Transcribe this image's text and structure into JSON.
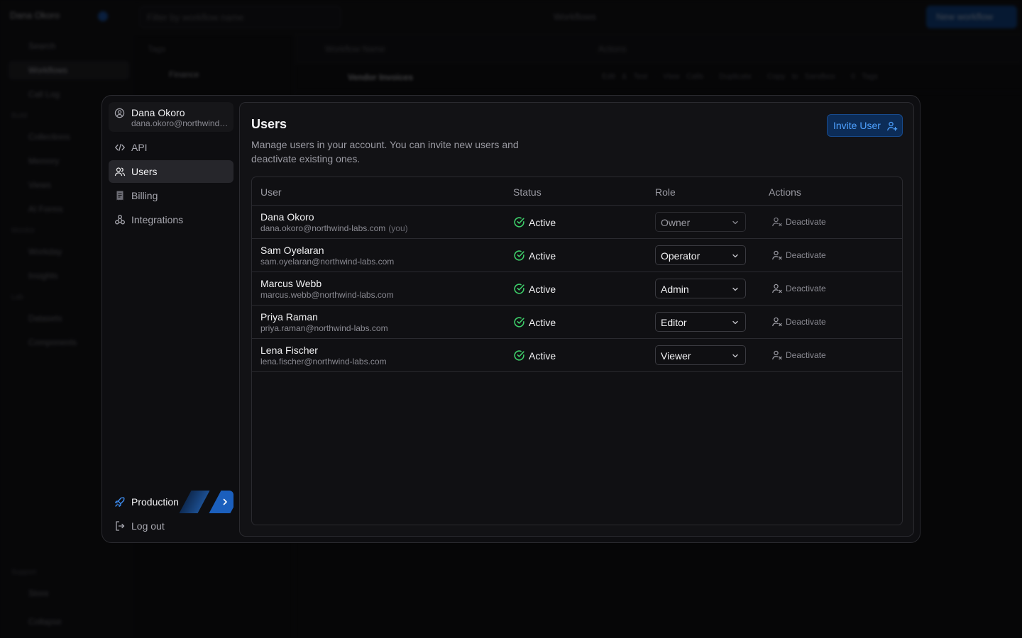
{
  "background": {
    "user_name": "Dana Okoro",
    "search_placeholder": "Filter by workflow name",
    "breadcrumb": "Workflows",
    "new_button": "New workflow",
    "nav": [
      {
        "label": "Search"
      },
      {
        "label": "Workflows"
      },
      {
        "label": "Call Log"
      },
      {
        "label": "Collections"
      },
      {
        "label": "Memory"
      },
      {
        "label": "Views"
      },
      {
        "label": "AI Forms"
      },
      {
        "label": "Workday"
      },
      {
        "label": "Insights"
      },
      {
        "label": "Datasets"
      },
      {
        "label": "Components"
      },
      {
        "label": "Store"
      },
      {
        "label": "Collapse"
      }
    ],
    "sections": [
      "Build",
      "Monitor",
      "Lab",
      "Support"
    ],
    "tags_header": "Tags",
    "tag_item": "Finance",
    "table_headers": [
      "Workflow Name",
      "Actions"
    ],
    "row_name": "Vendor Invoices",
    "row_actions": "Edit & Test · View Calls · Duplicate · Copy to Sandbox · 0 Tags"
  },
  "settings": {
    "profile": {
      "name": "Dana Okoro",
      "email": "dana.okoro@northwind-labs.com"
    },
    "nav": [
      {
        "label": "API",
        "icon": "code-icon",
        "active": false
      },
      {
        "label": "Users",
        "icon": "users-icon",
        "active": true
      },
      {
        "label": "Billing",
        "icon": "billing-icon",
        "active": false
      },
      {
        "label": "Integrations",
        "icon": "integrations-icon",
        "active": false
      }
    ],
    "environment": {
      "label": "Production",
      "icon": "rocket-icon"
    },
    "logout_label": "Log out"
  },
  "users_page": {
    "title": "Users",
    "description": "Manage users in your account. You can invite new users and deactivate existing ones.",
    "invite_label": "Invite User",
    "columns": [
      "User",
      "Status",
      "Role",
      "Actions"
    ],
    "rows": [
      {
        "name": "Dana Okoro",
        "email": "dana.okoro@northwind-labs.com",
        "you": "(you)",
        "status": "Active",
        "role": "Owner",
        "action": "Deactivate"
      },
      {
        "name": "Sam Oyelaran",
        "email": "sam.oyelaran@northwind-labs.com",
        "status": "Active",
        "role": "Operator",
        "action": "Deactivate"
      },
      {
        "name": "Marcus Webb",
        "email": "marcus.webb@northwind-labs.com",
        "status": "Active",
        "role": "Admin",
        "action": "Deactivate"
      },
      {
        "name": "Priya Raman",
        "email": "priya.raman@northwind-labs.com",
        "status": "Active",
        "role": "Editor",
        "action": "Deactivate"
      },
      {
        "name": "Lena Fischer",
        "email": "lena.fischer@northwind-labs.com",
        "status": "Active",
        "role": "Viewer",
        "action": "Deactivate"
      }
    ]
  },
  "colors": {
    "accent": "#4ea1ff",
    "status_active": "#3ecf6a",
    "active_nav": "#26262b"
  }
}
